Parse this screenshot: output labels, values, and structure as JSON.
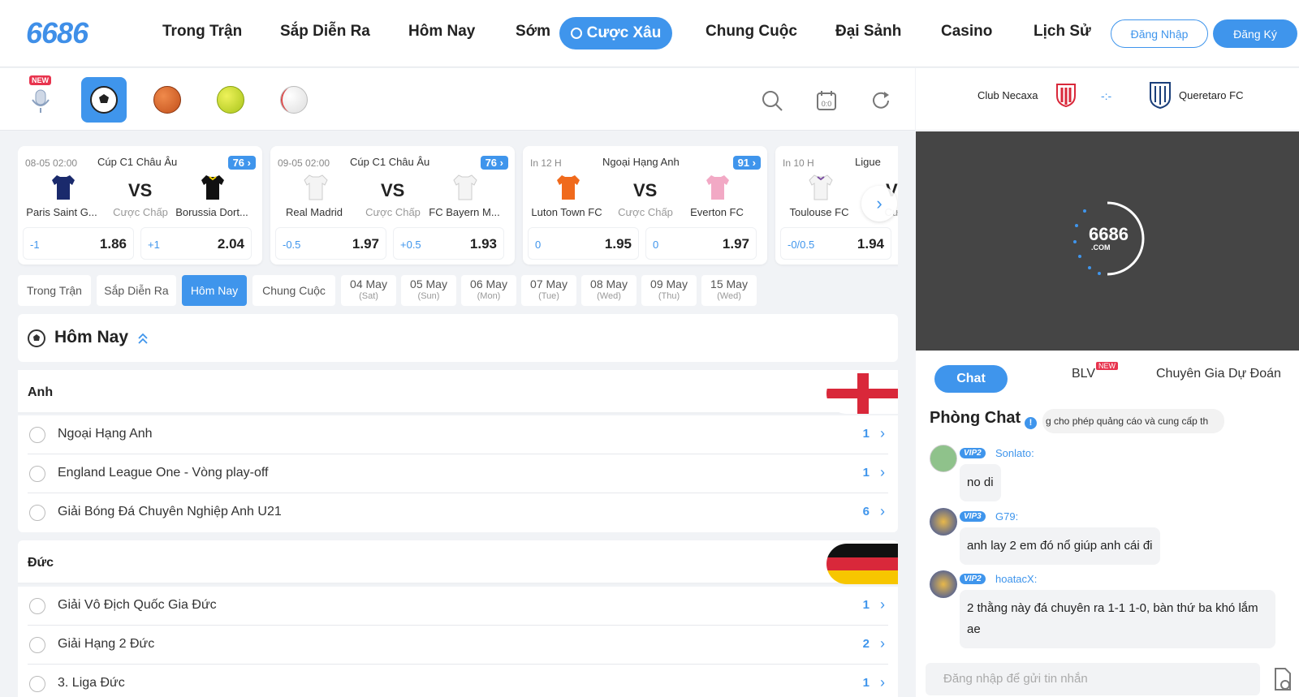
{
  "header": {
    "logo": "6686",
    "nav": [
      "Trong Trận",
      "Sắp Diễn Ra",
      "Hôm Nay",
      "Sớm",
      "Cược Xâu",
      "Chung Cuộc",
      "Đại Sảnh",
      "Casino",
      "Lịch Sử"
    ],
    "active_nav": "Cược Xâu",
    "login": "Đăng Nhập",
    "register": "Đăng Ký"
  },
  "sports": {
    "new_badge": "NEW",
    "items": [
      "microphone-icon",
      "soccer-icon",
      "basketball-icon",
      "tennis-icon",
      "baseball-icon"
    ],
    "active": "soccer-icon"
  },
  "cards": [
    {
      "time": "08-05 02:00",
      "league": "Cúp C1 Châu Âu",
      "count": "76",
      "home": "Paris Saint G...",
      "away": "Borussia Dort...",
      "vs": "VS",
      "type": "Cược Chấp",
      "h1": "-1",
      "o1": "1.86",
      "h2": "+1",
      "o2": "2.04",
      "home_color": "#1a2a6c",
      "away_color": "#111111"
    },
    {
      "time": "09-05 02:00",
      "league": "Cúp C1 Châu Âu",
      "count": "76",
      "home": "Real Madrid",
      "away": "FC Bayern M...",
      "vs": "VS",
      "type": "Cược Chấp",
      "h1": "-0.5",
      "o1": "1.97",
      "h2": "+0.5",
      "o2": "1.93",
      "home_color": "#f4f4f4",
      "away_color": "#f4f4f4"
    },
    {
      "time": "In 12 H",
      "league": "Ngoại Hạng Anh",
      "count": "91",
      "home": "Luton Town FC",
      "away": "Everton FC",
      "vs": "VS",
      "type": "Cược Chấp",
      "h1": "0",
      "o1": "1.95",
      "h2": "0",
      "o2": "1.97",
      "home_color": "#f06a1c",
      "away_color": "#f2a9c5"
    },
    {
      "time": "In 10 H",
      "league": "Ligue",
      "count": "",
      "home": "Toulouse FC",
      "away": "",
      "vs": "V",
      "type": "Cược",
      "h1": "-0/0.5",
      "o1": "1.94",
      "h2": "",
      "o2": "",
      "home_color": "#f4f4f4",
      "away_color": "#f4f4f4"
    }
  ],
  "date_tabs": [
    {
      "label": "Trong Trận",
      "sub": ""
    },
    {
      "label": "Sắp Diễn Ra",
      "sub": ""
    },
    {
      "label": "Hôm Nay",
      "sub": ""
    },
    {
      "label": "Chung Cuộc",
      "sub": ""
    },
    {
      "label": "04 May",
      "sub": "(Sat)"
    },
    {
      "label": "05 May",
      "sub": "(Sun)"
    },
    {
      "label": "06 May",
      "sub": "(Mon)"
    },
    {
      "label": "07 May",
      "sub": "(Tue)"
    },
    {
      "label": "08 May",
      "sub": "(Wed)"
    },
    {
      "label": "09 May",
      "sub": "(Thu)"
    },
    {
      "label": "15 May",
      "sub": "(Wed)"
    }
  ],
  "active_tab": "Hôm Nay",
  "section_title": "Hôm Nay",
  "countries": [
    {
      "name": "Anh",
      "leagues": [
        {
          "name": "Ngoại Hạng Anh",
          "count": "1"
        },
        {
          "name": "England League One - Vòng play-off",
          "count": "1"
        },
        {
          "name": "Giải Bóng Đá Chuyên Nghiệp Anh U21",
          "count": "6"
        }
      ]
    },
    {
      "name": "Đức",
      "leagues": [
        {
          "name": "Giải Vô Địch Quốc Gia Đức",
          "count": "1"
        },
        {
          "name": "Giải Hạng 2 Đức",
          "count": "2"
        },
        {
          "name": "3. Liga Đức",
          "count": "1"
        }
      ]
    }
  ],
  "match": {
    "home": "Club Necaxa",
    "away": "Queretaro FC",
    "score": "-:-"
  },
  "video_logo": "6686",
  "video_logo_sub": ".COM",
  "chat_tabs": {
    "chat": "Chat",
    "blv": "BLV",
    "blv_badge": "NEW",
    "expert": "Chuyên Gia Dự Đoán"
  },
  "chat_room": "Phòng Chat",
  "marquee": "g cho phép quảng cáo và cung cấp th",
  "messages": [
    {
      "vip": "VIP2",
      "user": "Sonlato:",
      "text": "no di"
    },
    {
      "vip": "VIP3",
      "user": "G79:",
      "text": "anh lay 2 em đó nổ giúp anh cái đi"
    },
    {
      "vip": "VIP2",
      "user": "hoatacX:",
      "text": "2 thằng này đá chuyên ra 1-1 1-0, bàn thứ ba khó lắm ae"
    }
  ],
  "chat_placeholder": "Đăng nhập để gửi tin nhắn",
  "colors": {
    "accent": "#3f95ec",
    "video_bg": "#454545"
  }
}
